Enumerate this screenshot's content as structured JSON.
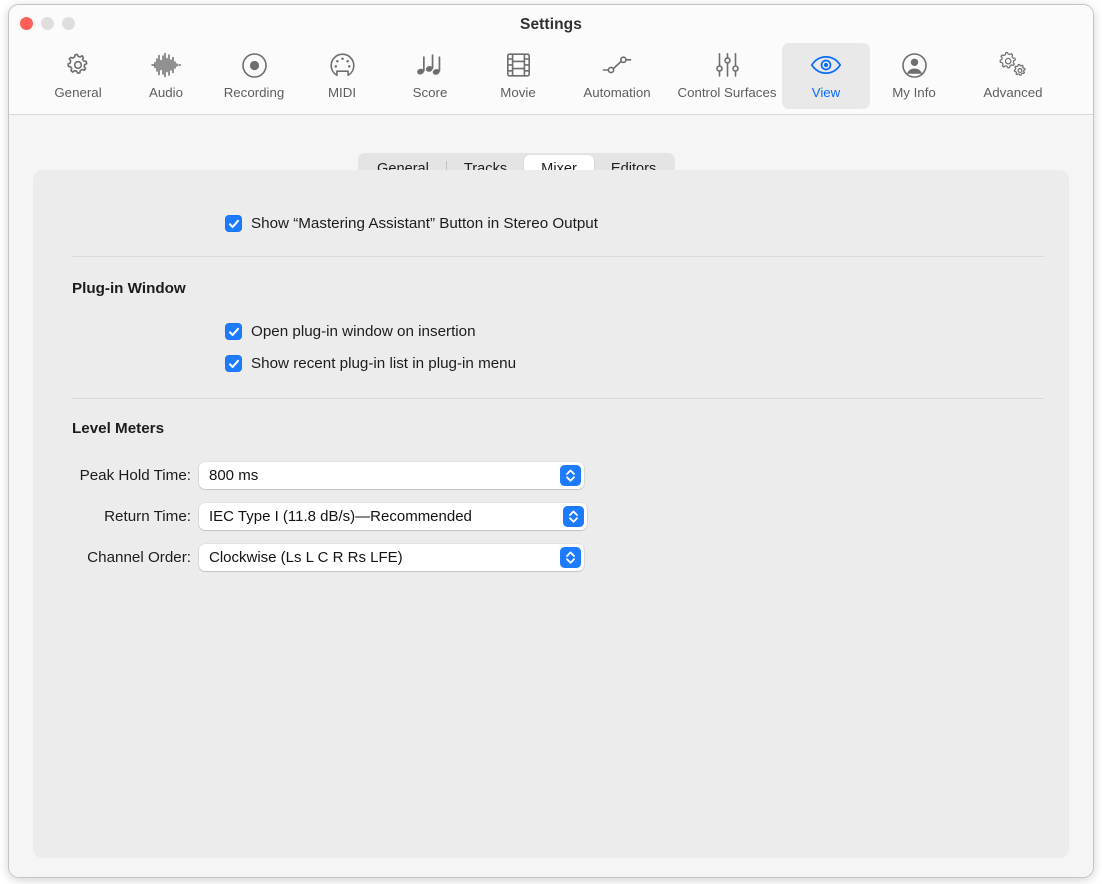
{
  "window": {
    "title": "Settings",
    "traffic_lights": [
      "close-button",
      "minimize-button",
      "zoom-button"
    ]
  },
  "toolbar": {
    "items": [
      {
        "label": "General",
        "icon": "gear-icon",
        "selected": false
      },
      {
        "label": "Audio",
        "icon": "waveform-icon",
        "selected": false
      },
      {
        "label": "Recording",
        "icon": "record-circle-icon",
        "selected": false
      },
      {
        "label": "MIDI",
        "icon": "midi-connector-icon",
        "selected": false
      },
      {
        "label": "Score",
        "icon": "music-notes-icon",
        "selected": false
      },
      {
        "label": "Movie",
        "icon": "film-strip-icon",
        "selected": false
      },
      {
        "label": "Automation",
        "icon": "automation-nodes-icon",
        "selected": false
      },
      {
        "label": "Control Surfaces",
        "icon": "sliders-icon",
        "selected": false
      },
      {
        "label": "View",
        "icon": "eye-icon",
        "selected": true
      },
      {
        "label": "My Info",
        "icon": "person-circle-icon",
        "selected": false
      },
      {
        "label": "Advanced",
        "icon": "double-gear-icon",
        "selected": false
      }
    ]
  },
  "tabs": {
    "items": [
      {
        "label": "General",
        "active": false
      },
      {
        "label": "Tracks",
        "active": false
      },
      {
        "label": "Mixer",
        "active": true
      },
      {
        "label": "Editors",
        "active": false
      }
    ]
  },
  "content": {
    "mastering_assistant": {
      "label": "Show “Mastering Assistant” Button in Stereo Output",
      "checked": true
    },
    "plugin_window": {
      "title": "Plug-in Window",
      "options": [
        {
          "label": "Open plug-in window on insertion",
          "checked": true
        },
        {
          "label": "Show recent plug-in list in plug-in menu",
          "checked": true
        }
      ]
    },
    "level_meters": {
      "title": "Level Meters",
      "fields": [
        {
          "label": "Peak Hold Time:",
          "value": "800 ms"
        },
        {
          "label": "Return Time:",
          "value": "IEC Type I (11.8 dB/s)—Recommended"
        },
        {
          "label": "Channel Order:",
          "value": "Clockwise (Ls L C R Rs LFE)"
        }
      ]
    }
  },
  "colors": {
    "accent": "#1d7bff",
    "selected_tab_text": "#0a6cff",
    "window_bg": "#f5f5f5",
    "panel_bg": "#ececec",
    "titlebar_bg": "#fbfbfb"
  }
}
